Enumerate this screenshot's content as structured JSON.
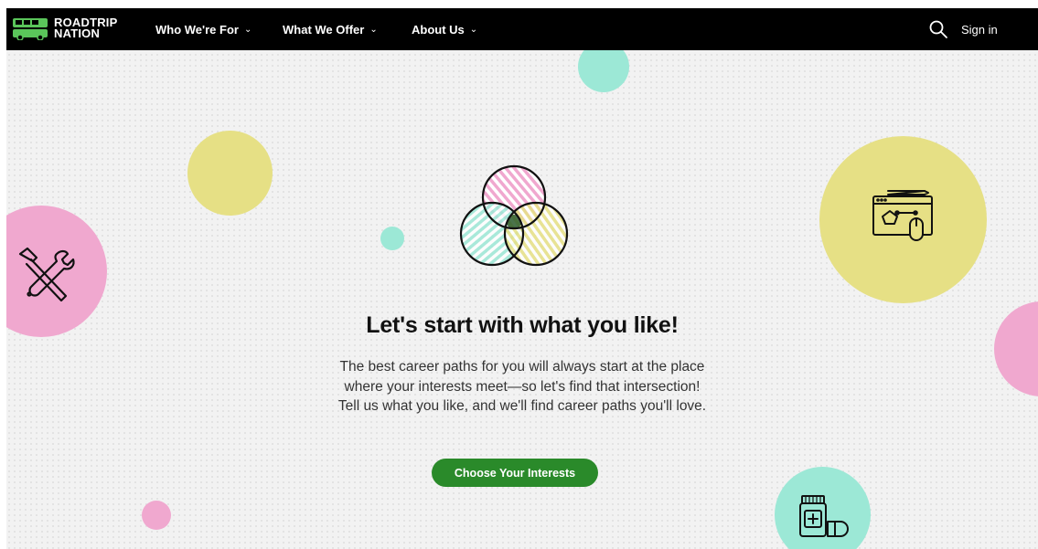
{
  "brand": {
    "logo_line1": "ROADTRIP",
    "logo_line2": "NATION",
    "accent": "#2a8a2a",
    "logo_green": "#5ac55a"
  },
  "navbar": {
    "items": [
      {
        "label": "Who We're For",
        "chevron": "⌄"
      },
      {
        "label": "What We Offer",
        "chevron": "⌄"
      },
      {
        "label": "About Us",
        "chevron": "⌄"
      }
    ],
    "search_icon": "search-icon",
    "sign_in": "Sign in"
  },
  "hero": {
    "headline": "Let's start with what you like!",
    "description": [
      "The best career paths for you will always start at the place",
      "where your interests meet—so let's find that intersection!",
      "Tell us what you like, and we'll find career paths you'll love."
    ],
    "cta": "Choose Your Interests"
  },
  "decor": {
    "colors": {
      "pink": "#f0a8cf",
      "yellow": "#e6e085",
      "mint": "#9ce8d6"
    },
    "icons": [
      "tools-icon",
      "web-design-icon",
      "medicine-icon",
      "venn-diagram-icon"
    ]
  }
}
